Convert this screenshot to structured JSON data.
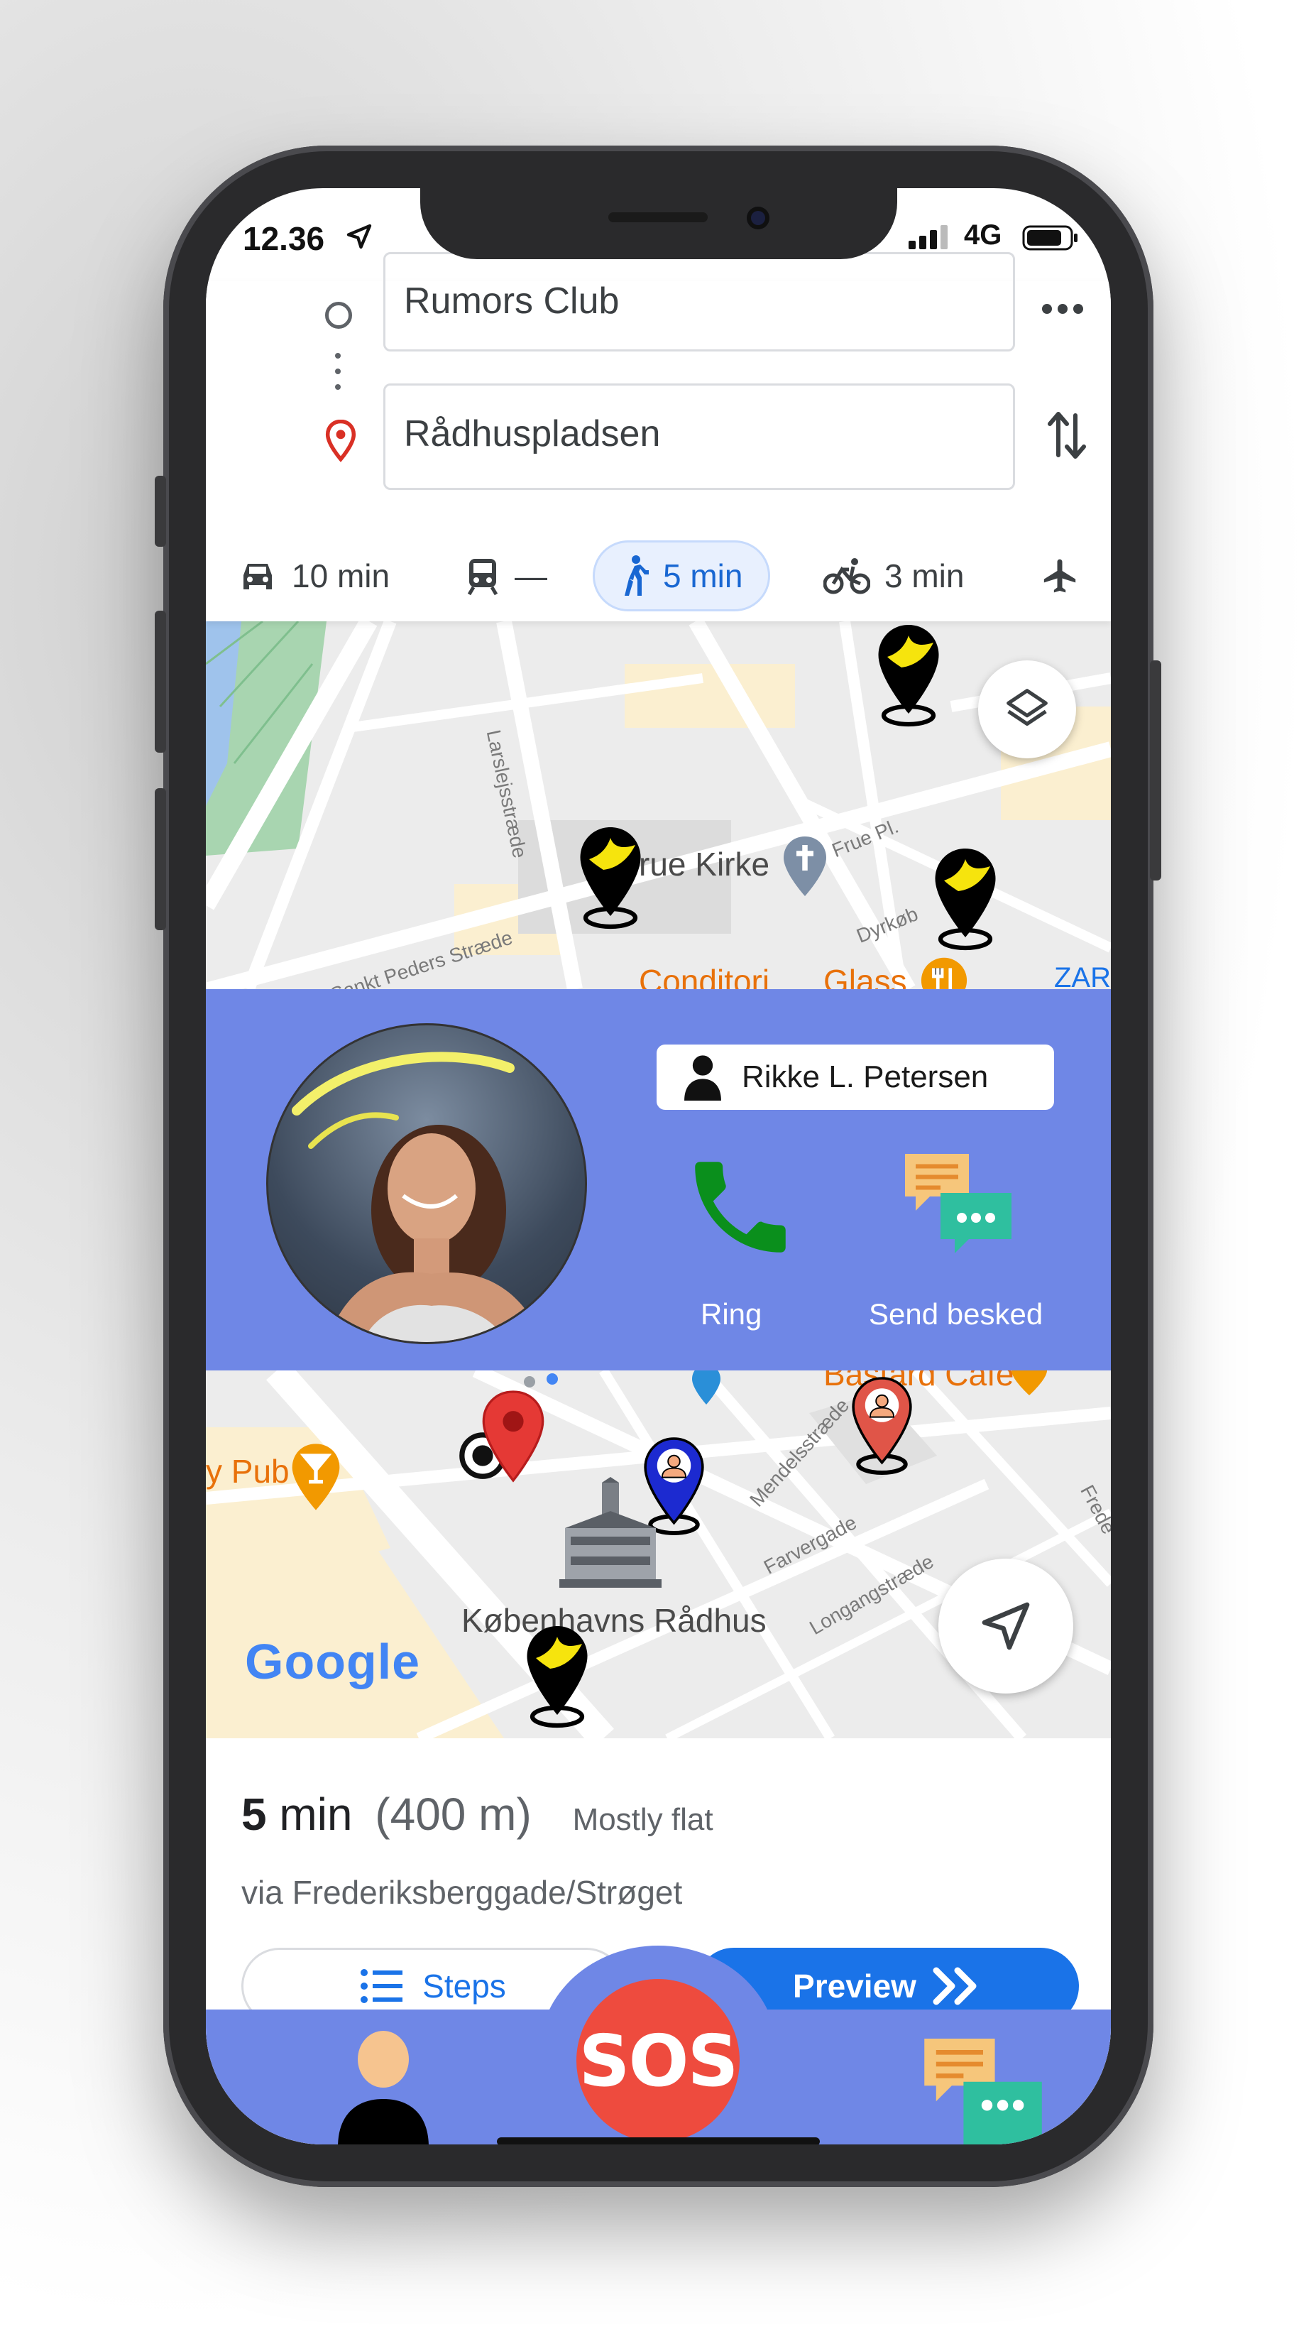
{
  "status_bar": {
    "time": "12.36",
    "network": "4G"
  },
  "route": {
    "origin": "Rumors Club",
    "destination": "Rådhuspladsen",
    "modes": [
      {
        "name": "car",
        "label": "10 min"
      },
      {
        "name": "transit",
        "label": "—"
      },
      {
        "name": "walk",
        "label": "5 min"
      },
      {
        "name": "bike",
        "label": "3 min"
      },
      {
        "name": "flight",
        "label": ""
      }
    ]
  },
  "map_top": {
    "labels": {
      "street_1": "Larslejsstræde",
      "church": "Vor Frue Kirke",
      "church_visible": "rue Kirke",
      "street_2": "Frue Pl.",
      "street_3": "Sankt Peders Stræde",
      "street_4": "Dyrkøb",
      "place_1": "Conditori",
      "place_2": "Glass",
      "edge": "ZAR"
    }
  },
  "contact": {
    "name": "Rikke L. Petersen",
    "call_label": "Ring",
    "message_label": "Send besked"
  },
  "map_bottom": {
    "labels": {
      "pub": "y Pub",
      "cafe": "Bastard Cafe",
      "street_1": "Mendelsstræde",
      "street_2": "Farvergade",
      "street_3": "Longangstræde",
      "street_4": "Frede",
      "landmark": "Københavns Rådhus",
      "brand": "Google"
    }
  },
  "summary": {
    "time_value": "5",
    "time_unit": "min",
    "distance": "(400 m)",
    "terrain": "Mostly flat",
    "via": "via Frederiksberggade/Strøget",
    "steps_label": "Steps",
    "preview_label": "Preview"
  },
  "bottom_nav": {
    "sos_label": "SOS"
  },
  "colors": {
    "accent_purple": "#6f87e6",
    "google_blue": "#1a73e8",
    "sos_red": "#ee4b3e",
    "call_green": "#0a8f1c"
  }
}
